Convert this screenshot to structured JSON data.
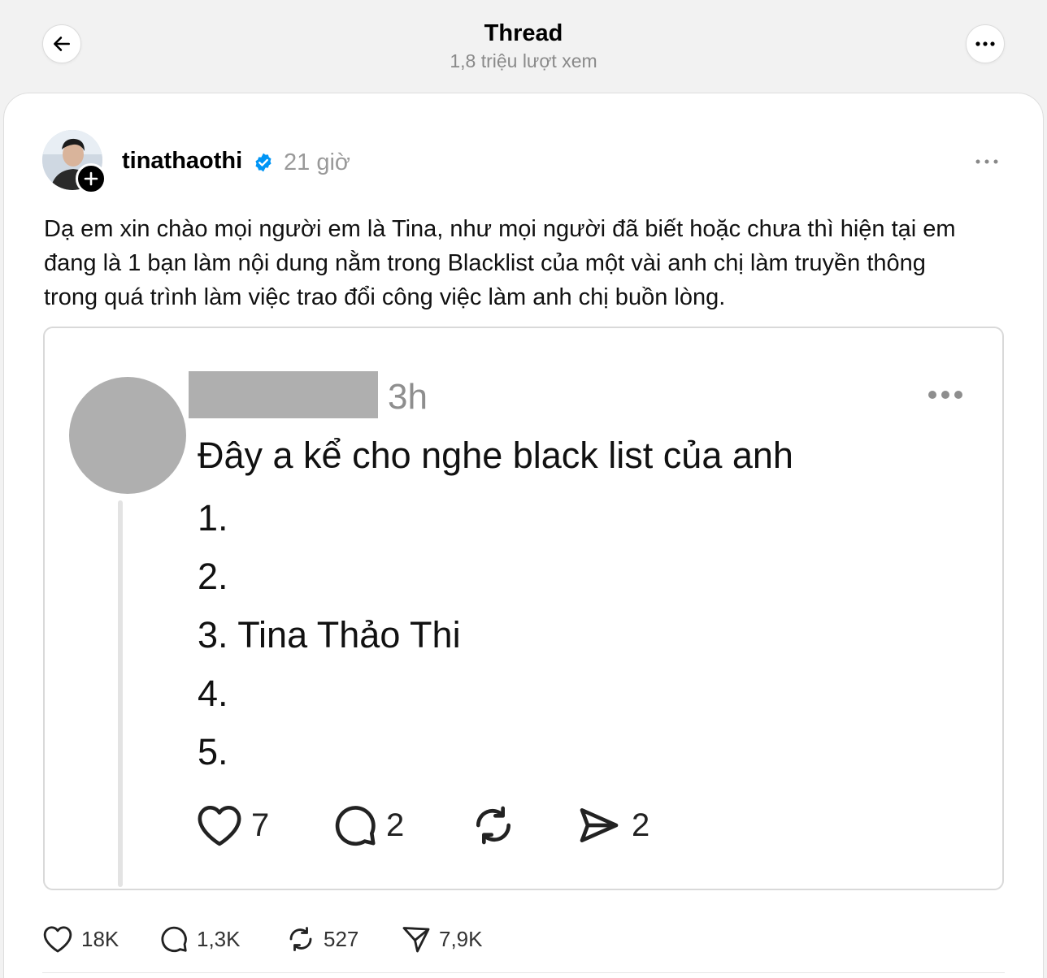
{
  "header": {
    "title": "Thread",
    "views": "1,8 triệu lượt xem"
  },
  "post": {
    "username": "tinathaothi",
    "time": "21 giờ",
    "text_lines": [
      "Dạ em xin chào mọi người em là Tina, như mọi người đã biết hoặc chưa thì hiện tại em",
      "đang là 1 bạn làm nội dung nằm trong Blacklist của một vài anh chị làm truyền thông",
      "trong quá trình làm việc trao đổi công việc làm anh chị buồn lòng."
    ],
    "stats": {
      "likes": "18K",
      "replies": "1,3K",
      "reposts": "527",
      "shares": "7,9K"
    }
  },
  "quoted": {
    "time": "3h",
    "text": "Đây a kể cho nghe black list của anh",
    "list": [
      {
        "num": "1.",
        "name": ""
      },
      {
        "num": "2.",
        "name": ""
      },
      {
        "num": "3.",
        "name": "Tina Thảo Thi"
      },
      {
        "num": "4.",
        "name": ""
      },
      {
        "num": "5.",
        "name": ""
      }
    ],
    "stats": {
      "likes": "7",
      "replies": "2",
      "shares": "2"
    }
  },
  "colors": {
    "verified": "#0095f6",
    "placeholder_gray": "#afafaf",
    "muted_text": "#999999"
  }
}
